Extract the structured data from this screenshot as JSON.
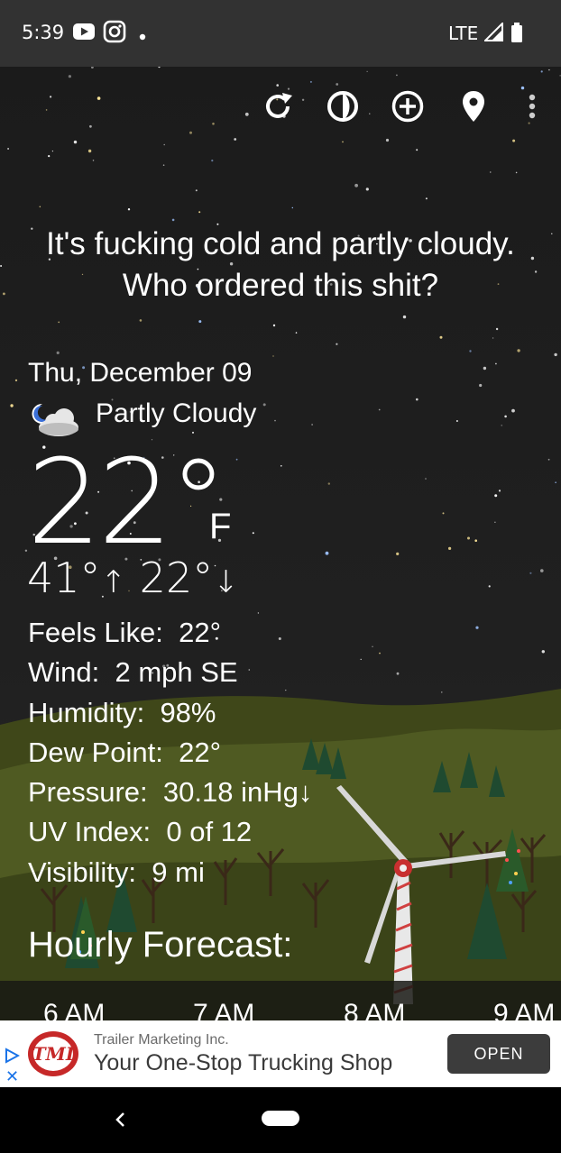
{
  "status_bar": {
    "time": "5:39",
    "network": "LTE",
    "icons": [
      "youtube-icon",
      "instagram-icon",
      "notification-dot-icon",
      "signal-icon",
      "battery-icon"
    ]
  },
  "toolbar": {
    "icons": [
      "refresh-icon",
      "radar-icon",
      "add-location-icon",
      "location-pin-icon",
      "more-vert-icon"
    ]
  },
  "tagline": "It's fucking cold and partly cloudy. Who ordered this shit?",
  "current": {
    "date": "Thu, December 09",
    "condition": "Partly Cloudy",
    "condition_icon": "partly-cloudy-night-icon",
    "temperature": "22°",
    "unit": "F",
    "high": "41°",
    "high_arrow": "↑",
    "low": "22°",
    "low_arrow": "↓"
  },
  "details": [
    {
      "label": "Feels Like:",
      "value": "22°"
    },
    {
      "label": "Wind:",
      "value": "2 mph SE"
    },
    {
      "label": "Humidity:",
      "value": "98%"
    },
    {
      "label": "Dew Point:",
      "value": "22°"
    },
    {
      "label": "Pressure:",
      "value": "30.18 inHg↓"
    },
    {
      "label": "UV Index:",
      "value": "0 of 12"
    },
    {
      "label": "Visibility:",
      "value": "9 mi"
    }
  ],
  "hourly": {
    "title": "Hourly Forecast:",
    "hours": [
      "6 AM",
      "7 AM",
      "8 AM",
      "9 AM"
    ]
  },
  "ad": {
    "advertiser": "Trailer Marketing Inc.",
    "headline": "Your One-Stop Trucking Shop",
    "cta": "OPEN",
    "logo_text": "TMI"
  },
  "colors": {
    "sky": "#1b1b1b",
    "status_bar": "#323232",
    "hill_green": "#4f5a22",
    "ad_button": "#3c3c3c"
  }
}
